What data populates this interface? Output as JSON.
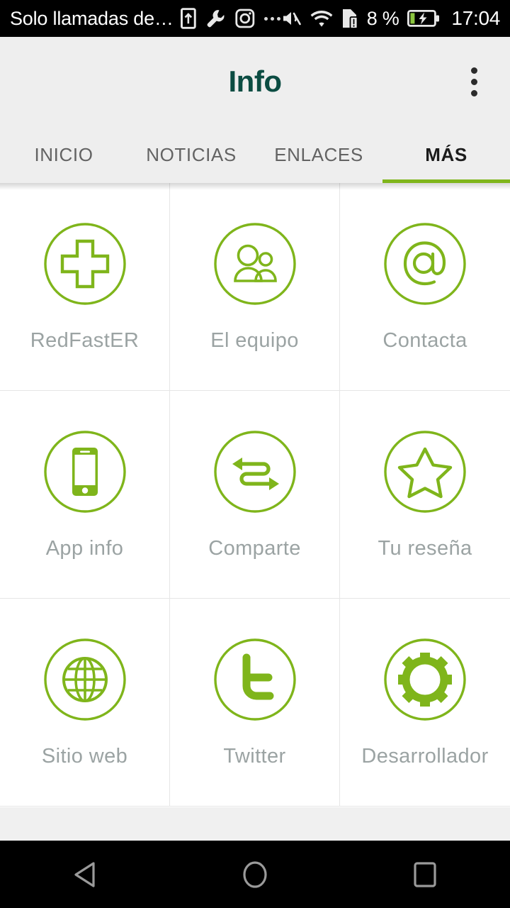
{
  "status_bar": {
    "carrier": "Solo llamadas de…",
    "left_icons": [
      "sim-upload-icon",
      "wrench-icon",
      "instagram-icon",
      "more-dots-icon"
    ],
    "right_icons": [
      "mute-icon",
      "wifi-icon",
      "sim-alert-icon"
    ],
    "battery_percent": "8 %",
    "battery_icon": "battery-charging-icon",
    "clock": "17:04"
  },
  "app_bar": {
    "title": "Info",
    "overflow_label": "overflow-menu",
    "title_color": "#0b4c42",
    "background": "#eeeeee"
  },
  "tabs": {
    "items": [
      {
        "label": "INICIO",
        "active": false
      },
      {
        "label": "NOTICIAS",
        "active": false
      },
      {
        "label": "ENLACES",
        "active": false
      },
      {
        "label": "MÁS",
        "active": true
      }
    ],
    "indicator_color": "#7fb51b"
  },
  "grid": {
    "accent_color": "#7fb51b",
    "label_color": "#9ba3a3",
    "tiles": [
      {
        "label": "RedFastER",
        "icon": "medical-cross-icon"
      },
      {
        "label": "El equipo",
        "icon": "people-group-icon"
      },
      {
        "label": "Contacta",
        "icon": "at-sign-icon"
      },
      {
        "label": "App info",
        "icon": "smartphone-icon"
      },
      {
        "label": "Comparte",
        "icon": "share-exchange-arrows-icon"
      },
      {
        "label": "Tu reseña",
        "icon": "star-outline-icon"
      },
      {
        "label": "Sitio web",
        "icon": "globe-icon"
      },
      {
        "label": "Twitter",
        "icon": "twitter-t-icon"
      },
      {
        "label": "Desarrollador",
        "icon": "gear-icon"
      }
    ]
  },
  "nav_bar": {
    "back": "back-triangle-icon",
    "home": "home-circle-icon",
    "recents": "recents-square-icon"
  }
}
